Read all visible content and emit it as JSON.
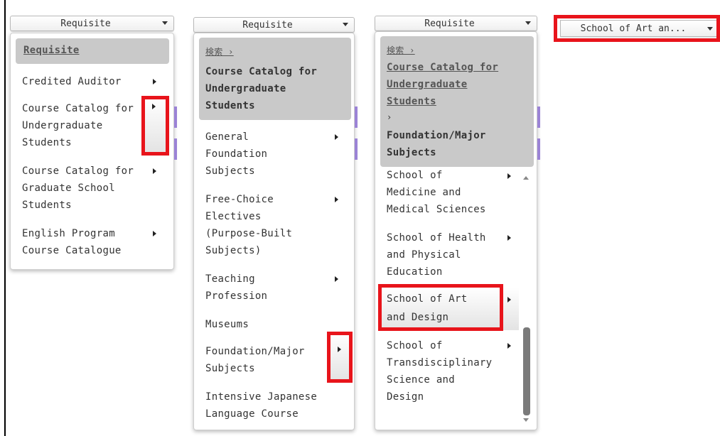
{
  "selects": {
    "s1": "Requisite",
    "s2": "Requisite",
    "s3": "Requisite",
    "s4": "School of Art an..."
  },
  "menu1": {
    "header": "Requisite",
    "items": [
      "Credited Auditor",
      "Course Catalog for",
      "Undergraduate",
      "Students",
      "Course Catalog for",
      "Graduate School",
      "Students",
      "English Program",
      "Course Catalogue"
    ]
  },
  "menu2": {
    "crumb": "検索 ›",
    "header_lines": [
      "Course Catalog for",
      "Undergraduate",
      "Students"
    ],
    "items": [
      "General",
      "Foundation",
      "Subjects",
      "Free-Choice",
      "Electives",
      "(Purpose-Built",
      "Subjects)",
      "Teaching",
      "Profession",
      "Museums",
      "Foundation/Major",
      "Subjects",
      "Intensive Japanese",
      "Language Course"
    ]
  },
  "menu3": {
    "crumb": "検索 ›",
    "link_lines": [
      "Course Catalog for",
      "Undergraduate",
      "Students"
    ],
    "crumb2": "›",
    "header_lines": [
      "Foundation/Major",
      "Subjects"
    ],
    "items": [
      "School of",
      "Medicine and",
      "Medical Sciences",
      "School of Health",
      "and Physical",
      "Education",
      "School of Art",
      "and Design",
      "School of",
      "Transdisciplinary",
      "Science and",
      "Design"
    ]
  },
  "colors": {
    "highlight": "#e8141b",
    "header": "#c9c9c9",
    "accent": "#9b83d6"
  }
}
